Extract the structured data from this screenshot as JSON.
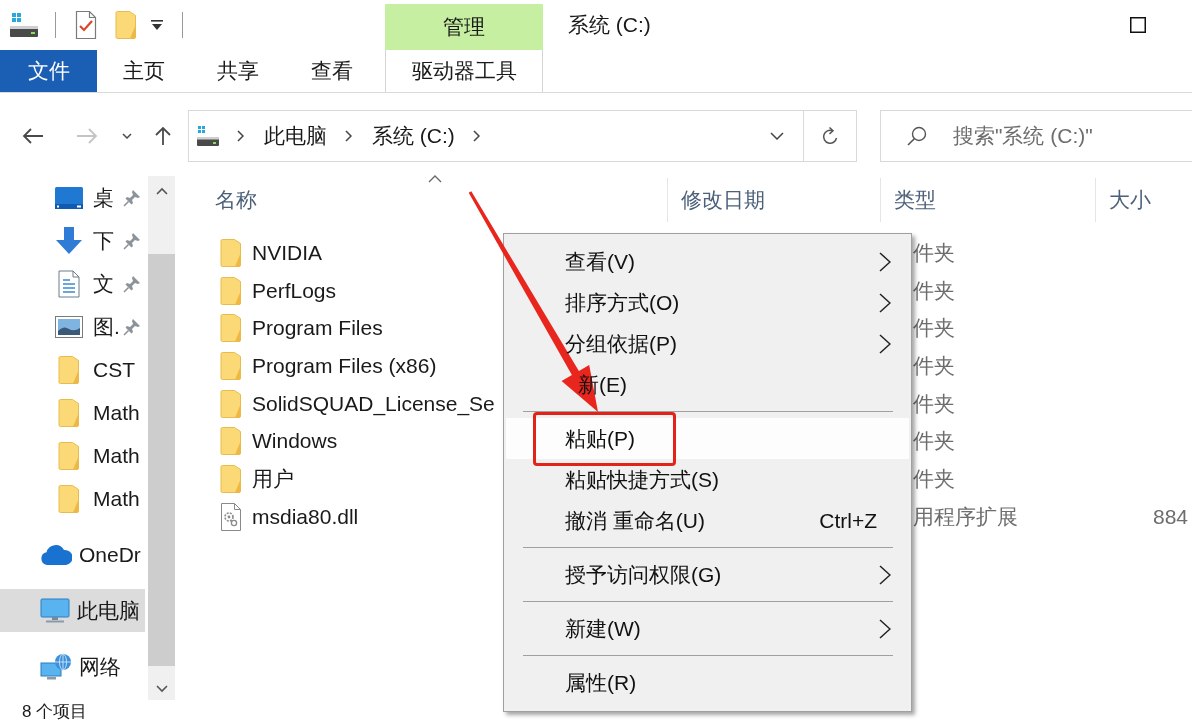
{
  "window": {
    "title": "系统 (C:)"
  },
  "ribbon": {
    "context_header": "管理",
    "tabs": [
      {
        "label": "文件",
        "kind": "file"
      },
      {
        "label": "主页",
        "kind": "tab"
      },
      {
        "label": "共享",
        "kind": "tab"
      },
      {
        "label": "查看",
        "kind": "tab"
      },
      {
        "label": "驱动器工具",
        "kind": "contextual"
      }
    ]
  },
  "nav_buttons": [
    {
      "kind": "back",
      "disabled": false
    },
    {
      "kind": "forward",
      "disabled": true
    },
    {
      "kind": "recent",
      "disabled": false
    },
    {
      "kind": "up",
      "disabled": false
    }
  ],
  "address_bar": {
    "breadcrumbs": [
      "此电脑",
      "系统 (C:)"
    ]
  },
  "search": {
    "placeholder": "搜索\"系统 (C:)\""
  },
  "sidebar": {
    "items": [
      {
        "name": "桌",
        "kind": "desktop",
        "pinned": true,
        "selected": false
      },
      {
        "name": "下",
        "kind": "downloads",
        "pinned": true,
        "selected": false
      },
      {
        "name": "文",
        "kind": "documents",
        "pinned": true,
        "selected": false
      },
      {
        "name": "图.",
        "kind": "pictures",
        "pinned": true,
        "selected": false
      },
      {
        "name": "CST",
        "kind": "folder",
        "pinned": false,
        "selected": false
      },
      {
        "name": "Math",
        "kind": "folder",
        "pinned": false,
        "selected": false
      },
      {
        "name": "Math",
        "kind": "folder",
        "pinned": false,
        "selected": false
      },
      {
        "name": "Math",
        "kind": "folder",
        "pinned": false,
        "selected": false
      },
      {
        "name": "OneDr",
        "kind": "onedrive",
        "pinned": false,
        "selected": false
      },
      {
        "name": "此电脑",
        "kind": "pc",
        "pinned": false,
        "selected": true
      },
      {
        "name": "网络",
        "kind": "network",
        "pinned": false,
        "selected": false
      }
    ]
  },
  "file_list": {
    "columns": [
      {
        "label": "名称",
        "sorted": true
      },
      {
        "label": "修改日期",
        "sorted": false
      },
      {
        "label": "类型",
        "sorted": false
      },
      {
        "label": "大小",
        "sorted": false
      }
    ],
    "rows": [
      {
        "kind": "folder",
        "name": "NVIDIA",
        "type": "件夹"
      },
      {
        "kind": "folder",
        "name": "PerfLogs",
        "type": "件夹"
      },
      {
        "kind": "folder",
        "name": "Program Files",
        "type": "件夹"
      },
      {
        "kind": "folder",
        "name": "Program Files (x86)",
        "type": "件夹"
      },
      {
        "kind": "folder",
        "name": "SolidSQUAD_License_Se",
        "type": "件夹"
      },
      {
        "kind": "folder",
        "name": "Windows",
        "type": "件夹"
      },
      {
        "kind": "folder",
        "name": "用户",
        "type": "件夹"
      },
      {
        "kind": "file",
        "name": "msdia80.dll",
        "type": "用程序扩展",
        "size": "884"
      }
    ]
  },
  "context_menu": {
    "groups": [
      {
        "items": [
          {
            "label": "查看(V)",
            "submenu": true,
            "selected": false,
            "callout": false,
            "covered": false
          },
          {
            "label": "排序方式(O)",
            "submenu": true,
            "selected": false,
            "callout": false,
            "covered": false
          },
          {
            "label": "分组依据(P)",
            "submenu": true,
            "selected": false,
            "callout": false,
            "covered": false
          },
          {
            "label": "新(E)",
            "submenu": false,
            "selected": false,
            "callout": false,
            "covered": true
          }
        ]
      },
      {
        "items": [
          {
            "label": "粘贴(P)",
            "submenu": false,
            "selected": true,
            "callout": true,
            "covered": false
          },
          {
            "label": "粘贴快捷方式(S)",
            "submenu": false,
            "selected": false,
            "callout": false,
            "covered": false
          },
          {
            "label": "撤消 重命名(U)",
            "shortcut": "Ctrl+Z",
            "submenu": false,
            "selected": false,
            "callout": false,
            "covered": false
          }
        ]
      },
      {
        "items": [
          {
            "label": "授予访问权限(G)",
            "submenu": true,
            "selected": false,
            "callout": false,
            "covered": false
          }
        ]
      },
      {
        "items": [
          {
            "label": "新建(W)",
            "submenu": true,
            "selected": false,
            "callout": false,
            "covered": false
          }
        ]
      },
      {
        "items": [
          {
            "label": "属性(R)",
            "submenu": false,
            "selected": false,
            "callout": false,
            "covered": false
          }
        ]
      }
    ]
  },
  "status_bar": {
    "text": "8 个项目"
  }
}
